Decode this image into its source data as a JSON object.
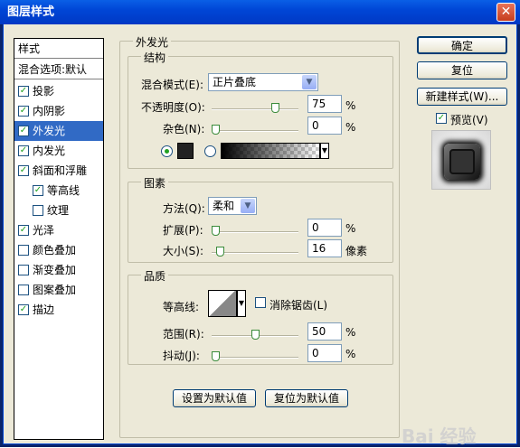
{
  "window": {
    "title": "图层样式",
    "close_icon": "close-icon"
  },
  "sidebar": {
    "header": "样式",
    "blend_options": "混合选项:默认",
    "items": [
      {
        "label": "投影",
        "checked": true
      },
      {
        "label": "内阴影",
        "checked": true
      },
      {
        "label": "外发光",
        "checked": true,
        "selected": true
      },
      {
        "label": "内发光",
        "checked": true
      },
      {
        "label": "斜面和浮雕",
        "checked": true
      },
      {
        "label": "等高线",
        "checked": true,
        "indent": true
      },
      {
        "label": "纹理",
        "checked": false,
        "indent": true
      },
      {
        "label": "光泽",
        "checked": true
      },
      {
        "label": "颜色叠加",
        "checked": false
      },
      {
        "label": "渐变叠加",
        "checked": false
      },
      {
        "label": "图案叠加",
        "checked": false
      },
      {
        "label": "描边",
        "checked": true
      }
    ]
  },
  "panel": {
    "title": "外发光",
    "structure": {
      "title": "结构",
      "blend_mode_label": "混合模式(E):",
      "blend_mode_value": "正片叠底",
      "opacity_label": "不透明度(O):",
      "opacity_value": "75",
      "opacity_unit": "%",
      "opacity_level": 0.75,
      "noise_label": "杂色(N):",
      "noise_value": "0",
      "noise_unit": "%",
      "noise_level": 0,
      "glow_color": "#222222",
      "color_mode": "solid"
    },
    "elements": {
      "title": "图素",
      "method_label": "方法(Q):",
      "method_value": "柔和",
      "spread_label": "扩展(P):",
      "spread_value": "0",
      "spread_unit": "%",
      "spread_level": 0,
      "size_label": "大小(S):",
      "size_value": "16",
      "size_unit": "像素",
      "size_level": 0.06
    },
    "quality": {
      "title": "品质",
      "contour_label": "等高线:",
      "antialias_label": "消除锯齿(L)",
      "antialias_checked": false,
      "range_label": "范围(R):",
      "range_value": "50",
      "range_unit": "%",
      "range_level": 0.5,
      "jitter_label": "抖动(J):",
      "jitter_value": "0",
      "jitter_unit": "%",
      "jitter_level": 0
    },
    "set_default": "设置为默认值",
    "reset_default": "复位为默认值"
  },
  "buttons": {
    "ok": "确定",
    "reset": "复位",
    "new_style": "新建样式(W)...",
    "preview_label": "预览(V)",
    "preview_checked": true
  },
  "watermark": "Bai 经验"
}
